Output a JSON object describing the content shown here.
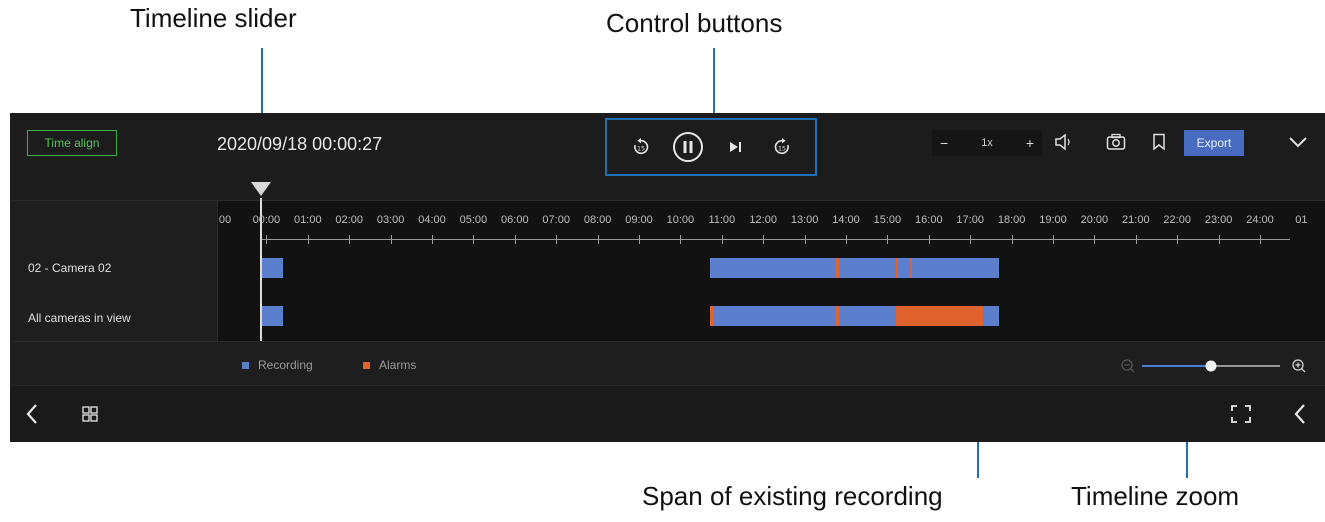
{
  "annotations": {
    "timeline_slider": "Timeline slider",
    "control_buttons": "Control buttons",
    "span_recording": "Span of existing recording",
    "timeline_zoom": "Timeline zoom"
  },
  "toolbar": {
    "time_align": "Time align",
    "datetime": "2020/09/18 00:00:27",
    "speed_minus": "−",
    "speed_value": "1x",
    "speed_plus": "+",
    "export": "Export",
    "icons": [
      "rewind-icon",
      "pause-icon",
      "skip-next-icon",
      "forward-icon",
      "volume-icon",
      "camera-icon",
      "bookmark-icon",
      "chevron-down-icon"
    ]
  },
  "timeline": {
    "ticks": [
      "00",
      "00:00",
      "01:00",
      "02:00",
      "03:00",
      "04:00",
      "05:00",
      "06:00",
      "07:00",
      "08:00",
      "09:00",
      "10:00",
      "11:00",
      "12:00",
      "13:00",
      "14:00",
      "15:00",
      "16:00",
      "17:00",
      "18:00",
      "19:00",
      "20:00",
      "21:00",
      "22:00",
      "23:00",
      "24:00",
      "01"
    ],
    "rows": [
      {
        "label": "02 - Camera 02"
      },
      {
        "label": "All cameras in view"
      }
    ]
  },
  "legend": {
    "recording": "Recording",
    "alarms": "Alarms",
    "recording_color": "#5b7fcc",
    "alarm_color": "#e0622e"
  },
  "zoom_level": 0.5,
  "bottom_icons": [
    "back-icon",
    "grid-icon",
    "fullscreen-icon",
    "collapse-icon"
  ]
}
